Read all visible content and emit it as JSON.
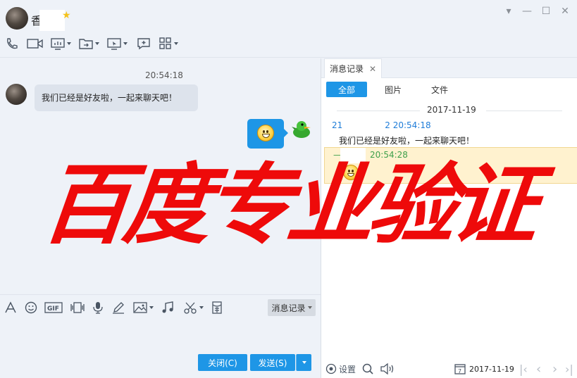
{
  "header": {
    "contact_name": "香",
    "icons": [
      "phone-icon",
      "video-icon",
      "screen-share-icon",
      "transfer-icon",
      "remote-desktop-icon",
      "add-chat-icon",
      "apps-icon"
    ]
  },
  "window": {
    "minimize": "▾",
    "min": "—",
    "max": "☐",
    "close": "✕"
  },
  "chat": {
    "time": "20:54:18",
    "incoming_message": "我们已经是好友啦，一起来聊天吧！"
  },
  "input_toolbar": {
    "history_button": "消息记录",
    "close_button": "关闭(C)",
    "send_button": "发送(S)"
  },
  "history_panel": {
    "tab_label": "消息记录",
    "filters": [
      "全部",
      "图片",
      "文件"
    ],
    "date": "2017-11-19",
    "entry1_head_prefix": "21",
    "entry1_head_suffix": "2 20:54:18",
    "entry1_text": "我们已经是好友啦，一起来聊天吧！",
    "entry2_head_prefix": "—",
    "entry2_head_time": "20:54:28",
    "footer_settings": "设置",
    "footer_date": "2017-11-19",
    "calendar_day": "7"
  },
  "watermark": "百度专业验证",
  "colors": {
    "accent": "#1e96e6",
    "watermark": "#ee0a0a",
    "highlight": "#fff2cf"
  }
}
